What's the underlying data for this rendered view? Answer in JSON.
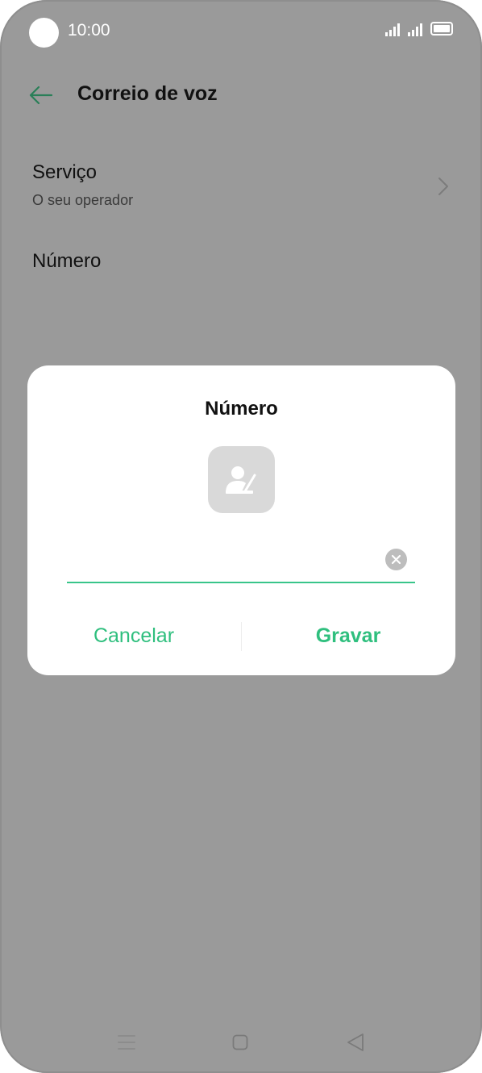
{
  "status_bar": {
    "time": "10:00"
  },
  "header": {
    "title": "Correio de voz",
    "back_icon": "arrow-left-icon"
  },
  "settings": {
    "service": {
      "title": "Serviço",
      "subtitle": "O seu operador"
    },
    "number": {
      "title": "Número"
    }
  },
  "dialog": {
    "title": "Número",
    "input_value": "",
    "cancel_label": "Cancelar",
    "save_label": "Gravar"
  },
  "colors": {
    "accent": "#2fbf7e",
    "scrim": "#9a9a9a",
    "dialog_bg": "#ffffff"
  }
}
